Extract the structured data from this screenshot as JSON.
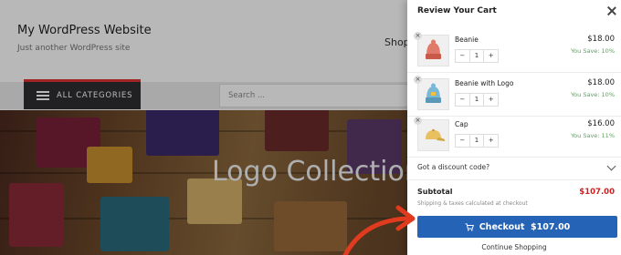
{
  "site": {
    "title": "My WordPress Website",
    "tagline": "Just another WordPress site",
    "nav_item": "Shop",
    "categories_label": "ALL CATEGORIES",
    "search_placeholder": "Search ...",
    "hero_title": "Logo Collection"
  },
  "cart": {
    "title": "Review Your Cart",
    "items": [
      {
        "name": "Beanie",
        "qty": "1",
        "price": "$18.00",
        "savings": "You Save: 10%",
        "icon": "beanie-icon"
      },
      {
        "name": "Beanie with Logo",
        "qty": "1",
        "price": "$18.00",
        "savings": "You Save: 10%",
        "icon": "beanie-logo-icon"
      },
      {
        "name": "Cap",
        "qty": "1",
        "price": "$16.00",
        "savings": "You Save: 11%",
        "icon": "cap-icon"
      }
    ],
    "qty_minus": "−",
    "qty_plus": "+",
    "remove_symbol": "×",
    "discount_label": "Got a discount code?",
    "subtotal_label": "Subtotal",
    "subtotal_value": "$107.00",
    "shipping_note": "Shipping & taxes calculated at checkout",
    "checkout_label": "Checkout  $107.00",
    "continue_label": "Continue Shopping"
  },
  "colors": {
    "accent": "#2563b7",
    "subtotal": "#d21f1f",
    "savings": "#5aa45a",
    "arrow": "#e03a1f"
  }
}
